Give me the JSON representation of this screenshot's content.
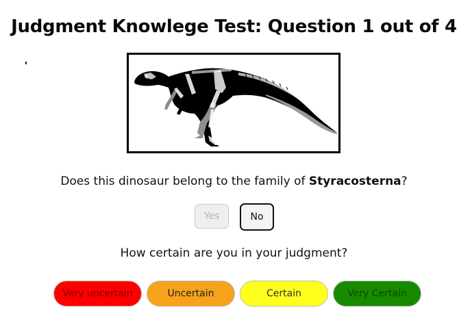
{
  "header": {
    "title": "Judgment Knowlege Test: Question 1 out of 4"
  },
  "question": {
    "prefix": "Does this dinosaur belong to the family of ",
    "family": "Styracosterna",
    "suffix": "?"
  },
  "answers": {
    "yes_label": "Yes",
    "no_label": "No"
  },
  "certainty": {
    "prompt": "How certain are you in your judgment?",
    "options": [
      "Very uncertain",
      "Uncertain",
      "Certain",
      "Very Certain"
    ]
  },
  "colors": {
    "very_uncertain": "#ff0000",
    "uncertain": "#f7a21b",
    "certain": "#ffff1e",
    "very_certain": "#188a00"
  },
  "image": {
    "icon": "dinosaur-skeletal-diagram-icon"
  }
}
